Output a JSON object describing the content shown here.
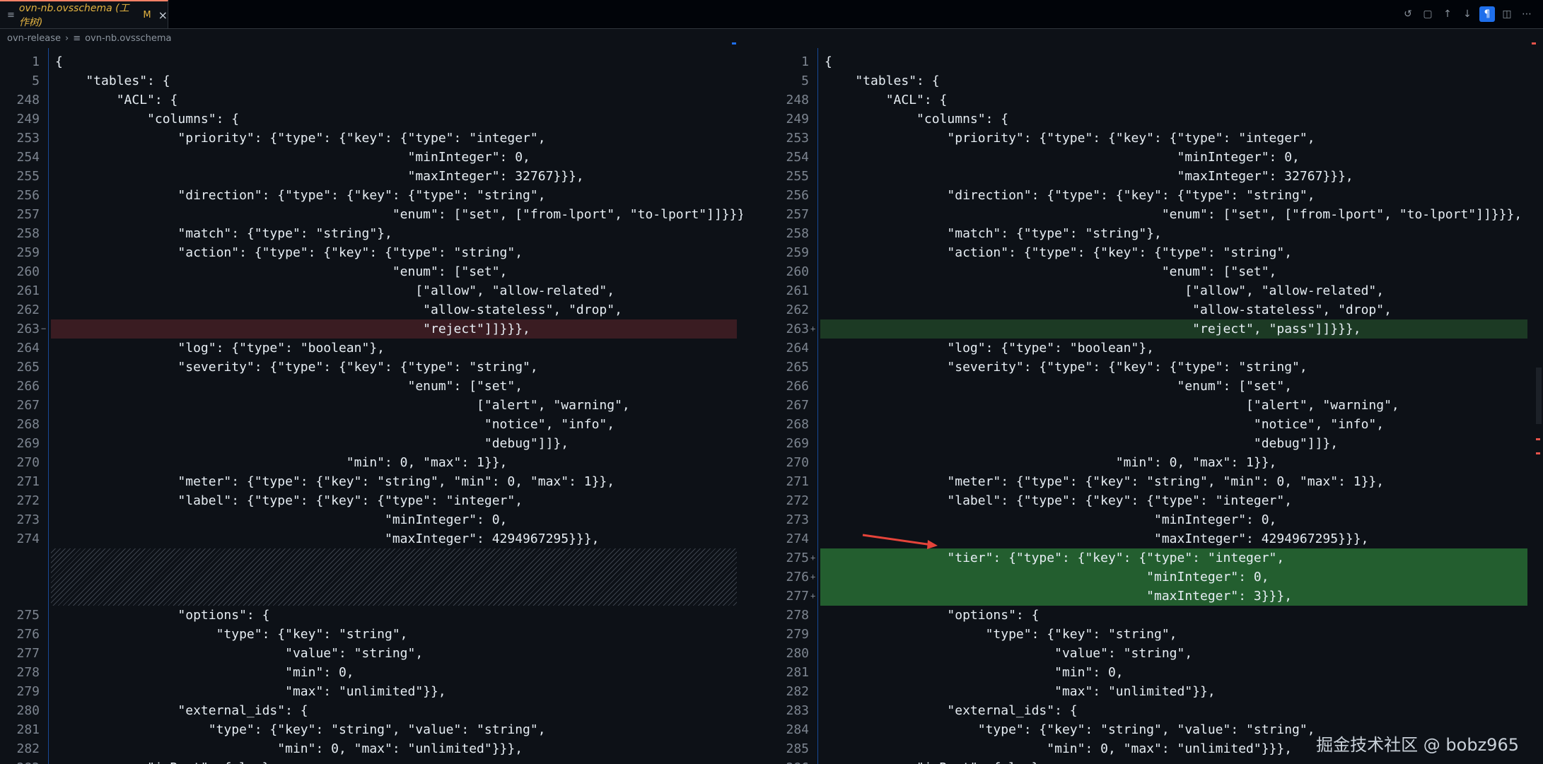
{
  "tab": {
    "label": "ovn-nb.ovsschema (工作树)",
    "modified": "M",
    "close": "×",
    "file_icon": "≡"
  },
  "toolbar": {
    "icons": [
      "history-icon",
      "file-icon",
      "arrow-up-icon",
      "arrow-down-icon",
      "pilcrow-icon",
      "split-view-icon",
      "more-icon"
    ],
    "glyphs": [
      "↺",
      "▢",
      "↑",
      "↓",
      "¶",
      "◫",
      "⋯"
    ]
  },
  "breadcrumb": {
    "folder": "ovn-release",
    "sep": "›",
    "file_icon": "≡",
    "file": "ovn-nb.ovsschema"
  },
  "colors": {
    "deleted": "#3a1c22",
    "added": "#1c3a24",
    "added_strong": "#235e2f",
    "accent": "#1f6feb"
  },
  "left": {
    "lines": [
      {
        "n": "1",
        "t": "{"
      },
      {
        "n": "5",
        "t": "    \"tables\": {"
      },
      {
        "n": "248",
        "t": "        \"ACL\": {"
      },
      {
        "n": "249",
        "t": "            \"columns\": {"
      },
      {
        "n": "253",
        "t": "                \"priority\": {\"type\": {\"key\": {\"type\": \"integer\","
      },
      {
        "n": "254",
        "t": "                                              \"minInteger\": 0,"
      },
      {
        "n": "255",
        "t": "                                              \"maxInteger\": 32767}}},"
      },
      {
        "n": "256",
        "t": "                \"direction\": {\"type\": {\"key\": {\"type\": \"string\","
      },
      {
        "n": "257",
        "t": "                                            \"enum\": [\"set\", [\"from-lport\", \"to-lport\"]]}}}"
      },
      {
        "n": "258",
        "t": "                \"match\": {\"type\": \"string\"},"
      },
      {
        "n": "259",
        "t": "                \"action\": {\"type\": {\"key\": {\"type\": \"string\","
      },
      {
        "n": "260",
        "t": "                                            \"enum\": [\"set\","
      },
      {
        "n": "261",
        "t": "                                               [\"allow\", \"allow-related\","
      },
      {
        "n": "262",
        "t": "                                                \"allow-stateless\", \"drop\","
      },
      {
        "n": "263",
        "t": "                                                \"reject\"]]}}},",
        "mark": "del"
      },
      {
        "n": "264",
        "t": "                \"log\": {\"type\": \"boolean\"},"
      },
      {
        "n": "265",
        "t": "                \"severity\": {\"type\": {\"key\": {\"type\": \"string\","
      },
      {
        "n": "266",
        "t": "                                              \"enum\": [\"set\","
      },
      {
        "n": "267",
        "t": "                                                       [\"alert\", \"warning\","
      },
      {
        "n": "268",
        "t": "                                                        \"notice\", \"info\","
      },
      {
        "n": "269",
        "t": "                                                        \"debug\"]]},"
      },
      {
        "n": "270",
        "t": "                                      \"min\": 0, \"max\": 1}},"
      },
      {
        "n": "271",
        "t": "                \"meter\": {\"type\": {\"key\": \"string\", \"min\": 0, \"max\": 1}},"
      },
      {
        "n": "272",
        "t": "                \"label\": {\"type\": {\"key\": {\"type\": \"integer\","
      },
      {
        "n": "273",
        "t": "                                           \"minInteger\": 0,"
      },
      {
        "n": "274",
        "t": "                                           \"maxInteger\": 4294967295}}},"
      },
      {
        "n": "",
        "t": "",
        "filler": true
      },
      {
        "n": "",
        "t": "",
        "filler": true
      },
      {
        "n": "",
        "t": "",
        "filler": true
      },
      {
        "n": "275",
        "t": "                \"options\": {"
      },
      {
        "n": "276",
        "t": "                     \"type\": {\"key\": \"string\","
      },
      {
        "n": "277",
        "t": "                              \"value\": \"string\","
      },
      {
        "n": "278",
        "t": "                              \"min\": 0,"
      },
      {
        "n": "279",
        "t": "                              \"max\": \"unlimited\"}},"
      },
      {
        "n": "280",
        "t": "                \"external_ids\": {"
      },
      {
        "n": "281",
        "t": "                    \"type\": {\"key\": \"string\", \"value\": \"string\","
      },
      {
        "n": "282",
        "t": "                             \"min\": 0, \"max\": \"unlimited\"}}},"
      },
      {
        "n": "283",
        "t": "            \"isRoot\": false},"
      }
    ]
  },
  "right": {
    "lines": [
      {
        "n": "1",
        "t": "{"
      },
      {
        "n": "5",
        "t": "    \"tables\": {"
      },
      {
        "n": "248",
        "t": "        \"ACL\": {"
      },
      {
        "n": "249",
        "t": "            \"columns\": {"
      },
      {
        "n": "253",
        "t": "                \"priority\": {\"type\": {\"key\": {\"type\": \"integer\","
      },
      {
        "n": "254",
        "t": "                                              \"minInteger\": 0,"
      },
      {
        "n": "255",
        "t": "                                              \"maxInteger\": 32767}}},"
      },
      {
        "n": "256",
        "t": "                \"direction\": {\"type\": {\"key\": {\"type\": \"string\","
      },
      {
        "n": "257",
        "t": "                                            \"enum\": [\"set\", [\"from-lport\", \"to-lport\"]]}}},"
      },
      {
        "n": "258",
        "t": "                \"match\": {\"type\": \"string\"},"
      },
      {
        "n": "259",
        "t": "                \"action\": {\"type\": {\"key\": {\"type\": \"string\","
      },
      {
        "n": "260",
        "t": "                                            \"enum\": [\"set\","
      },
      {
        "n": "261",
        "t": "                                               [\"allow\", \"allow-related\","
      },
      {
        "n": "262",
        "t": "                                                \"allow-stateless\", \"drop\","
      },
      {
        "n": "263",
        "t": "                                                \"reject\", \"pass\"]]}}},",
        "mark": "add"
      },
      {
        "n": "264",
        "t": "                \"log\": {\"type\": \"boolean\"},"
      },
      {
        "n": "265",
        "t": "                \"severity\": {\"type\": {\"key\": {\"type\": \"string\","
      },
      {
        "n": "266",
        "t": "                                              \"enum\": [\"set\","
      },
      {
        "n": "267",
        "t": "                                                       [\"alert\", \"warning\","
      },
      {
        "n": "268",
        "t": "                                                        \"notice\", \"info\","
      },
      {
        "n": "269",
        "t": "                                                        \"debug\"]]},"
      },
      {
        "n": "270",
        "t": "                                      \"min\": 0, \"max\": 1}},"
      },
      {
        "n": "271",
        "t": "                \"meter\": {\"type\": {\"key\": \"string\", \"min\": 0, \"max\": 1}},"
      },
      {
        "n": "272",
        "t": "                \"label\": {\"type\": {\"key\": {\"type\": \"integer\","
      },
      {
        "n": "273",
        "t": "                                           \"minInteger\": 0,"
      },
      {
        "n": "274",
        "t": "                                           \"maxInteger\": 4294967295}}},"
      },
      {
        "n": "275",
        "t": "                \"tier\": {\"type\": {\"key\": {\"type\": \"integer\",",
        "mark": "addfull"
      },
      {
        "n": "276",
        "t": "                                          \"minInteger\": 0,",
        "mark": "addfull"
      },
      {
        "n": "277",
        "t": "                                          \"maxInteger\": 3}}},",
        "mark": "addfull"
      },
      {
        "n": "278",
        "t": "                \"options\": {"
      },
      {
        "n": "279",
        "t": "                     \"type\": {\"key\": \"string\","
      },
      {
        "n": "280",
        "t": "                              \"value\": \"string\","
      },
      {
        "n": "281",
        "t": "                              \"min\": 0,"
      },
      {
        "n": "282",
        "t": "                              \"max\": \"unlimited\"}},"
      },
      {
        "n": "283",
        "t": "                \"external_ids\": {"
      },
      {
        "n": "284",
        "t": "                    \"type\": {\"key\": \"string\", \"value\": \"string\","
      },
      {
        "n": "285",
        "t": "                             \"min\": 0, \"max\": \"unlimited\"}}},"
      },
      {
        "n": "286",
        "t": "            \"isRoot\": false},"
      }
    ]
  },
  "watermark": "掘金技术社区 @ bobz965"
}
